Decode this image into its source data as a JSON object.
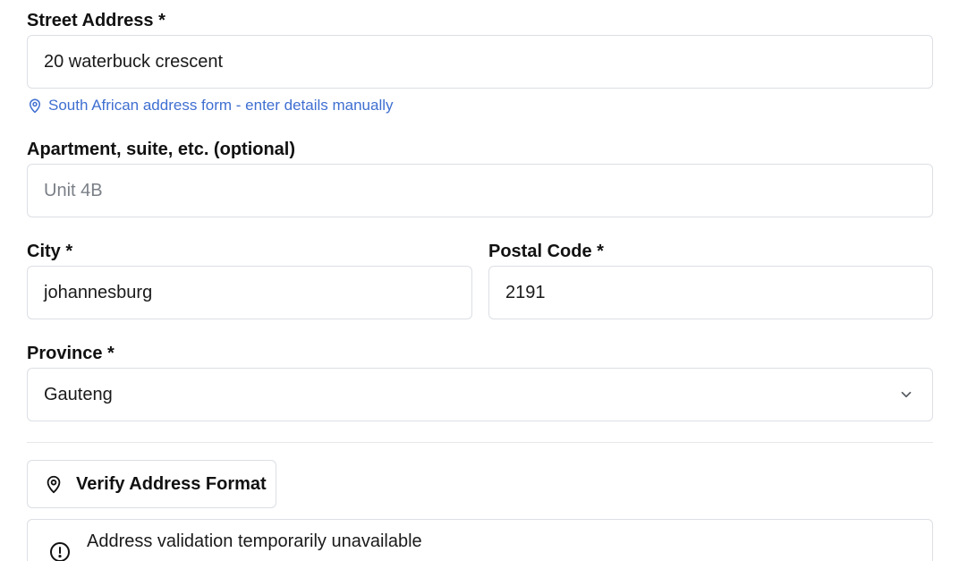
{
  "street": {
    "label": "Street Address *",
    "value": "20 waterbuck crescent",
    "hint": "South African address form - enter details manually",
    "hint_icon": "map-pin-icon"
  },
  "apartment": {
    "label": "Apartment, suite, etc. (optional)",
    "placeholder": "Unit 4B"
  },
  "city": {
    "label": "City *",
    "value": "johannesburg"
  },
  "postal": {
    "label": "Postal Code *",
    "value": "2191"
  },
  "province": {
    "label": "Province *",
    "selected": "Gauteng",
    "icon": "chevron-down-icon"
  },
  "verify": {
    "label": "Verify Address Format",
    "icon": "map-pin-icon"
  },
  "alert": {
    "message": "Address validation temporarily unavailable",
    "icon": "alert-circle-icon"
  },
  "colors": {
    "hint": "#3f6fd1",
    "border": "#dcdfe4",
    "placeholder": "#7a7f87"
  }
}
